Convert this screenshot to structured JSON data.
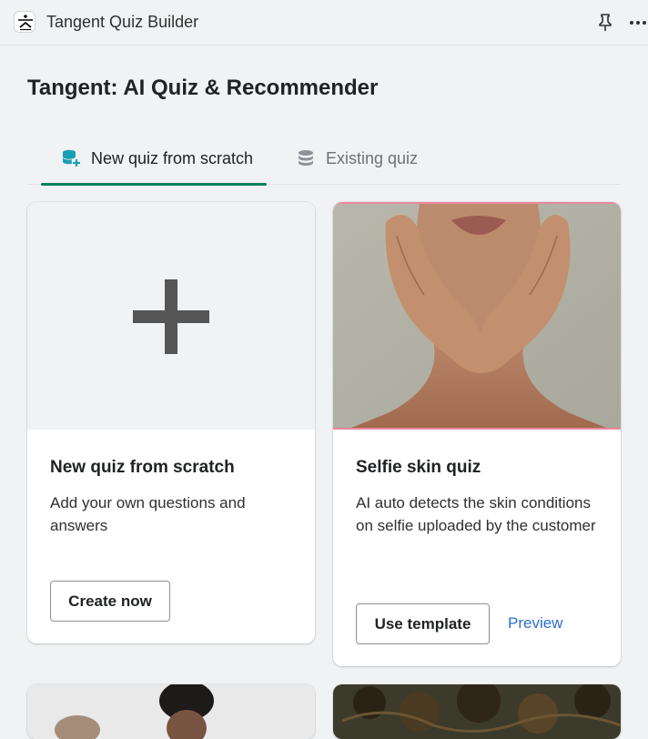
{
  "app": {
    "title": "Tangent Quiz Builder",
    "logo_icon": "tangent-logo-icon",
    "pin_icon": "pin-icon",
    "more_icon": "more-horizontal-icon"
  },
  "page": {
    "title": "Tangent: AI Quiz & Recommender"
  },
  "tabs": [
    {
      "label": "New quiz from scratch",
      "icon": "database-plus-icon",
      "active": true,
      "color": "#00805a"
    },
    {
      "label": "Existing quiz",
      "icon": "database-icon",
      "active": false
    }
  ],
  "cards": [
    {
      "title": "New quiz from scratch",
      "description": "Add your own questions and answers",
      "media_icon": "plus-icon",
      "button_label": "Create now"
    },
    {
      "title": "Selfie skin quiz",
      "description": "AI auto detects the skin conditions on selfie uploaded by the customer",
      "media": "face-with-hands-photo",
      "button_label": "Use template",
      "link_label": "Preview"
    },
    {
      "media": "woman-portrait-photo"
    },
    {
      "media": "curly-hair-portrait-photo"
    }
  ],
  "colors": {
    "accent": "#00805a",
    "link": "#2c6ecb",
    "background": "#f1f2f3"
  }
}
